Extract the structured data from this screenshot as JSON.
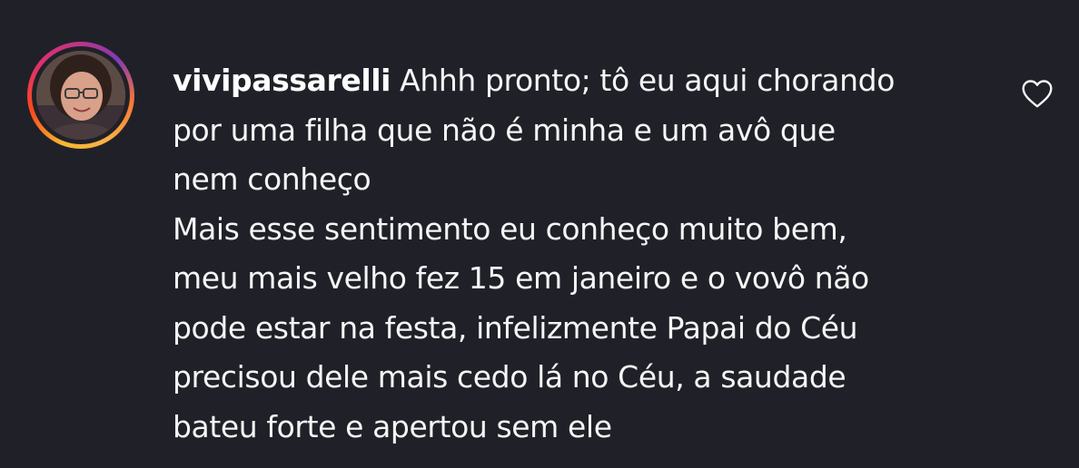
{
  "comment": {
    "username": "vivipassarelli",
    "first_line_text": " Ahhh pronto; tô eu aqui chorando",
    "lines": [
      "por uma filha que não é minha e um avô que",
      "nem conheço",
      "Mais esse sentimento eu conheço muito bem,",
      "meu mais velho fez 15 em janeiro e o vovô não",
      "pode estar na festa, infelizmente Papai do Céu",
      "precisou dele mais cedo lá no Céu, a saudade",
      "bateu forte e apertou sem ele"
    ],
    "avatar_icon": "profile-photo",
    "like_icon": "heart-outline-icon"
  },
  "colors": {
    "background": "#202128",
    "text": "#f5f5f5",
    "story_ring": [
      "#f7b733",
      "#e1306c",
      "#833ab4"
    ]
  }
}
